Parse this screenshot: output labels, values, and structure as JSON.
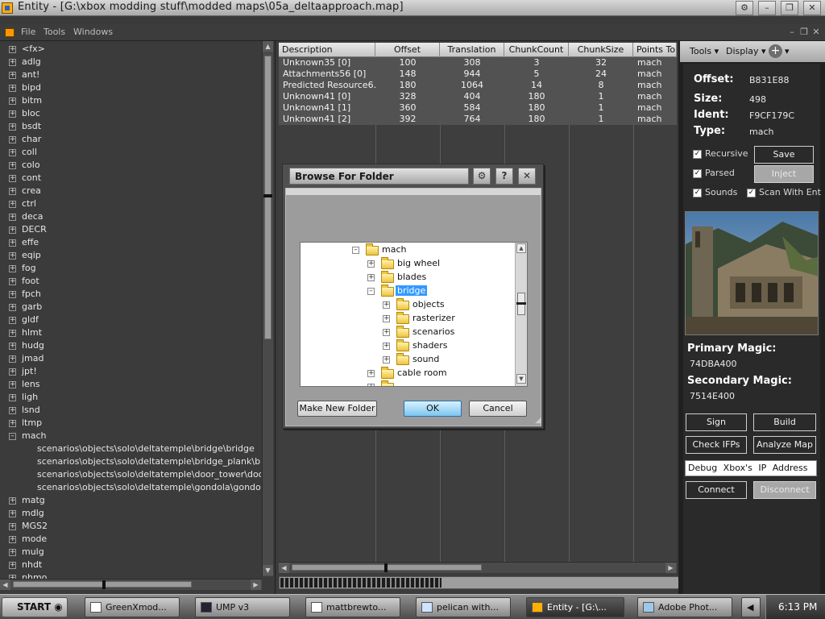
{
  "window": {
    "title": "Entity - [G:\\xbox modding stuff\\modded maps\\05a_deltaapproach.map]"
  },
  "menu": {
    "items": [
      "File",
      "Tools",
      "Windows"
    ]
  },
  "tree": {
    "nodes": [
      "<fx>",
      "adlg",
      "ant!",
      "bipd",
      "bitm",
      "bloc",
      "bsdt",
      "char",
      "coll",
      "colo",
      "cont",
      "crea",
      "ctrl",
      "deca",
      "DECR",
      "effe",
      "eqip",
      "fog",
      "foot",
      "fpch",
      "garb",
      "gldf",
      "hlmt",
      "hudg",
      "jmad",
      "jpt!",
      "lens",
      "ligh",
      "lsnd",
      "ltmp",
      "mach"
    ],
    "mach_children": [
      "scenarios\\objects\\solo\\deltatemple\\bridge\\bridge",
      "scenarios\\objects\\solo\\deltatemple\\bridge_plank\\bridge_p",
      "scenarios\\objects\\solo\\deltatemple\\door_tower\\door_towe",
      "scenarios\\objects\\solo\\deltatemple\\gondola\\gondola_laun"
    ],
    "after": [
      "matg",
      "mdlg",
      "MGS2",
      "mode",
      "mulg",
      "nhdt",
      "phmo"
    ]
  },
  "grid": {
    "columns": [
      "Description",
      "Offset",
      "Translation",
      "ChunkCount",
      "ChunkSize",
      "Points To"
    ],
    "rows": [
      [
        "Unknown35 [0]",
        "100",
        "308",
        "3",
        "32",
        "mach"
      ],
      [
        "Attachments56 [0]",
        "148",
        "944",
        "5",
        "24",
        "mach"
      ],
      [
        "Predicted Resource6...",
        "180",
        "1064",
        "14",
        "8",
        "mach"
      ],
      [
        "Unknown41 [0]",
        "328",
        "404",
        "180",
        "1",
        "mach"
      ],
      [
        "Unknown41 [1]",
        "360",
        "584",
        "180",
        "1",
        "mach"
      ],
      [
        "Unknown41 [2]",
        "392",
        "764",
        "180",
        "1",
        "mach"
      ]
    ]
  },
  "right": {
    "tools_label": "Tools",
    "display_label": "Display",
    "offset_label": "Offset:",
    "offset_val": "B831E88",
    "size_label": "Size:",
    "size_val": "498",
    "ident_label": "Ident:",
    "ident_val": "F9CF179C",
    "type_label": "Type:",
    "type_val": "mach",
    "recursive": "Recursive",
    "parsed": "Parsed",
    "sounds": "Sounds",
    "scan_with_ent": "Scan With Ent",
    "save": "Save",
    "inject": "Inject",
    "primary_magic_label": "Primary Magic:",
    "primary_magic": "74DBA400",
    "secondary_magic_label": "Secondary Magic:",
    "secondary_magic": "7514E400",
    "sign": "Sign",
    "build": "Build",
    "check_ifps": "Check IFPs",
    "analyze_map": "Analyze Map",
    "debug_ip": "Debug Xbox's IP Address",
    "connect": "Connect",
    "disconnect": "Disconnect"
  },
  "dialog": {
    "title": "Browse For Folder",
    "folders": {
      "mach": "mach",
      "big_wheel": "big wheel",
      "blades": "blades",
      "bridge": "bridge",
      "objects": "objects",
      "rasterizer": "rasterizer",
      "scenarios": "scenarios",
      "shaders": "shaders",
      "sound": "sound",
      "cable_room": "cable room"
    },
    "make_new_folder": "Make New Folder",
    "ok": "OK",
    "cancel": "Cancel"
  },
  "taskbar": {
    "start": "START",
    "tasks": [
      "GreenXmod...",
      "UMP v3",
      "mattbrewto...",
      "pelican with...",
      "Entity - [G:\\...",
      "Adobe Phot..."
    ],
    "clock": "6:13 PM"
  },
  "colors": {
    "selection": "#3399ff",
    "ok_button": "#7ec5ef",
    "panel_bg": "#3b3b3b",
    "right_panel": "#202020"
  }
}
